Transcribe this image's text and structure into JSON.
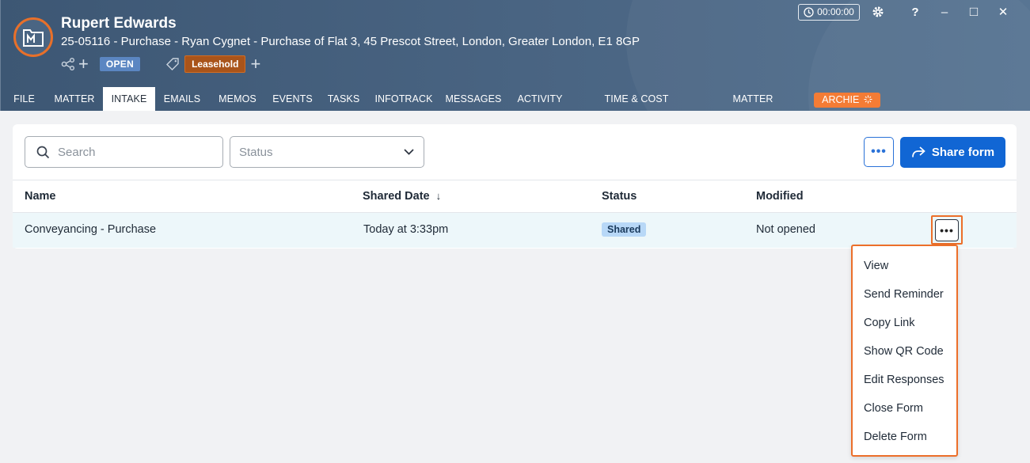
{
  "header": {
    "client_name": "Rupert Edwards",
    "matter_description": "25-05116 - Purchase - Ryan Cygnet - Purchase of Flat 3, 45 Prescot Street, London, Greater London, E1 8GP",
    "status_badge": "OPEN",
    "tag_label": "Leasehold",
    "timer": "00:00:00",
    "window_controls": {
      "help": "?",
      "minimize": "–",
      "maximize": "□",
      "close": "✕"
    }
  },
  "tabs": [
    {
      "label": "FILE"
    },
    {
      "label": "MATTER"
    },
    {
      "label": "INTAKE",
      "active": true
    },
    {
      "label": "EMAILS"
    },
    {
      "label": "MEMOS"
    },
    {
      "label": "EVENTS"
    },
    {
      "label": "TASKS"
    },
    {
      "label": "INFOTRACK"
    },
    {
      "label": "MESSAGES"
    },
    {
      "label": "ACTIVITY"
    },
    {
      "label": "TIME & COST RECOVERIES"
    },
    {
      "label": "MATTER INSIGHTS"
    },
    {
      "label": "ARCHIE"
    }
  ],
  "toolbar": {
    "search_placeholder": "Search",
    "status_placeholder": "Status",
    "more_label": "•••",
    "share_label": "Share form"
  },
  "table": {
    "columns": [
      "Name",
      "Shared Date",
      "Status",
      "Modified"
    ],
    "sort_indicator": "↓",
    "rows": [
      {
        "name": "Conveyancing - Purchase",
        "shared_date": "Today at 3:33pm",
        "status": "Shared",
        "modified": "Not opened",
        "actions": "•••"
      }
    ]
  },
  "row_menu": {
    "items": [
      "View",
      "Send Reminder",
      "Copy Link",
      "Show QR Code",
      "Edit Responses",
      "Close Form",
      "Delete Form"
    ]
  },
  "colors": {
    "header_bg": "#4a6583",
    "accent_orange": "#ec6f2a",
    "primary_blue": "#1166d4",
    "open_badge": "#5b86c2",
    "leasehold_badge": "#a9541a",
    "shared_badge": "#b8d8f7"
  },
  "icons": [
    "matter-logo-icon",
    "share-tree-icon",
    "plus-icon",
    "tag-icon",
    "clock-icon",
    "gear-icon",
    "help-icon",
    "minimize-icon",
    "maximize-icon",
    "close-icon",
    "search-icon",
    "chevron-down-icon",
    "share-arrow-icon",
    "sparkle-icon"
  ]
}
